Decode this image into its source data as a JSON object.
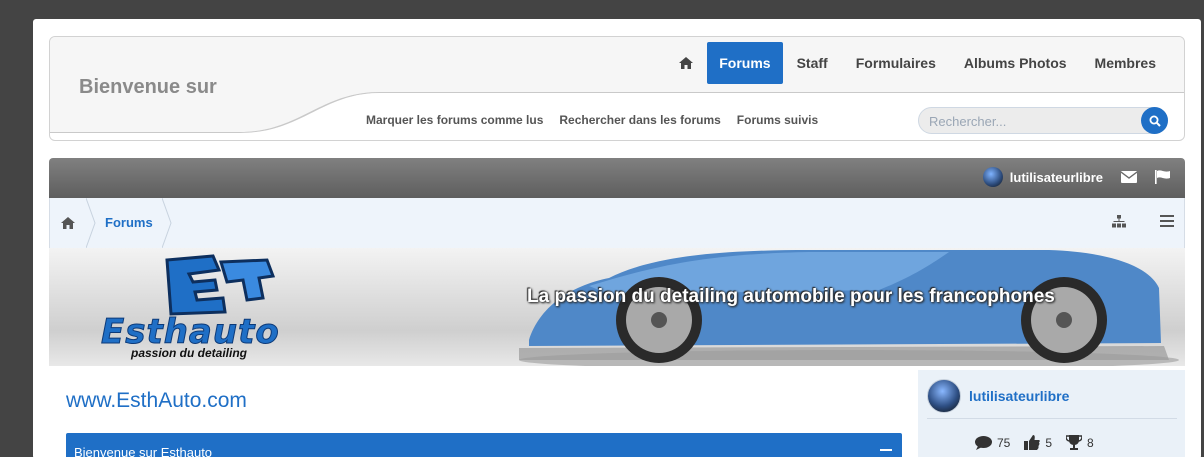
{
  "header": {
    "welcome": "Bienvenue sur",
    "nav": [
      "Forums",
      "Staff",
      "Formulaires",
      "Albums Photos",
      "Membres"
    ],
    "subnav": [
      "Marquer les forums comme lus",
      "Rechercher dans les forums",
      "Forums suivis"
    ],
    "search_placeholder": "Rechercher..."
  },
  "userbar": {
    "username": "lutilisateurlibre"
  },
  "breadcrumb": {
    "current": "Forums"
  },
  "banner": {
    "tagline": "La passion du detailing automobile pour les francophones",
    "logo_text": "Esthauto",
    "logo_subtext": "passion du detailing"
  },
  "main": {
    "site_link": "www.EsthAuto.com",
    "block_title": "Bienvenue sur Esthauto"
  },
  "sidebar": {
    "username": "lutilisateurlibre",
    "stats": {
      "messages": "75",
      "likes": "5",
      "trophies": "8"
    }
  },
  "colors": {
    "accent": "#1f6fc6",
    "userbar": "#6a6a6a",
    "background": "#444444"
  },
  "icons": [
    "home-icon",
    "search-icon",
    "envelope-icon",
    "flag-icon",
    "sitemap-icon",
    "list-icon",
    "comment-icon",
    "thumbs-up-icon",
    "trophy-icon"
  ]
}
